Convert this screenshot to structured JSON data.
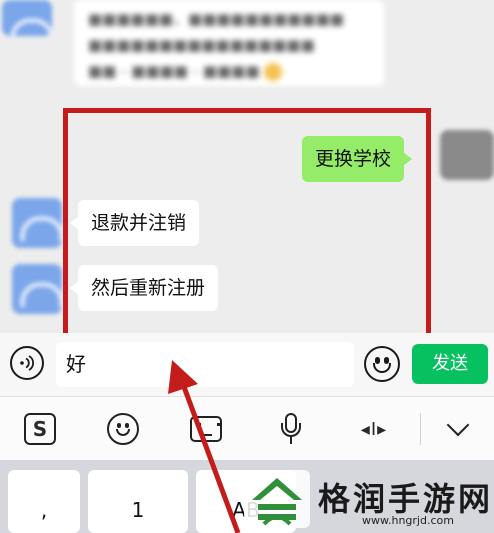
{
  "chat": {
    "blurred_message": {
      "line1": "■■■■■■，■■■■■■■■■■■",
      "line2": "■■■■■■■■■■■■■■■■",
      "line3": "■■ - ■■■■ - ■■■■"
    },
    "messages": [
      {
        "side": "right",
        "text": "更换学校"
      },
      {
        "side": "left",
        "text": "退款并注销"
      },
      {
        "side": "left",
        "text": "然后重新注册"
      }
    ]
  },
  "input_bar": {
    "value": "好",
    "send_label": "发送"
  },
  "keyboard_toolbar": {
    "sogou_label": "S",
    "cursor_label": "◂I▸"
  },
  "keyboard_keys": [
    ",",
    "1",
    "AB"
  ],
  "watermark": {
    "title": "格润手游网",
    "url": "www.hngrjd.com"
  },
  "colors": {
    "send_button": "#07c160",
    "sent_bubble": "#95ec69",
    "highlight_border": "#c41b1b",
    "arrow": "#c41b1b"
  }
}
